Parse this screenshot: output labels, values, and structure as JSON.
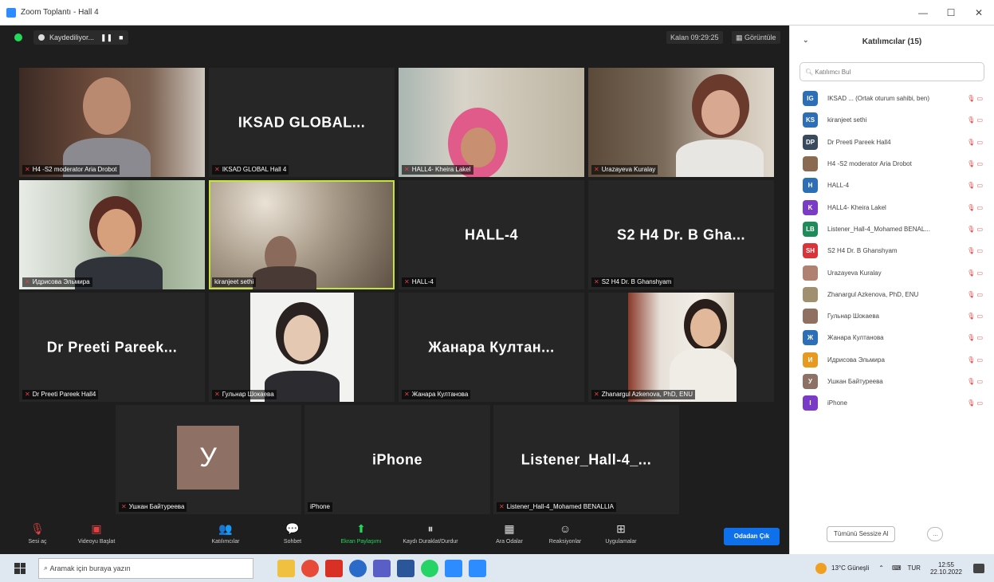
{
  "window": {
    "title": "Zoom Toplantı - Hall 4",
    "minimize": "—",
    "maximize": "☐",
    "close": "✕"
  },
  "topbar": {
    "recording": "Kaydediliyor...",
    "pause": "❚❚",
    "stop": "■",
    "timer": "Kalan 09:29:25",
    "view": "Görüntüle"
  },
  "tiles": {
    "t1": {
      "label": "H4 -S2 moderator Aria Drobot"
    },
    "t2": {
      "big": "IKSAD GLOBAL...",
      "label": "IKSAD GLOBAL Hall 4"
    },
    "t3": {
      "label": "HALL4- Kheira Lakel"
    },
    "t4": {
      "label": "Urazayeva Kuralay"
    },
    "t5": {
      "label": "Идрисова Эльмира"
    },
    "t6": {
      "label": "kiranjeet sethi"
    },
    "t7": {
      "big": "HALL-4",
      "label": "HALL-4"
    },
    "t8": {
      "big": "S2 H4 Dr. B Gha...",
      "label": "S2 H4 Dr. B Ghanshyam"
    },
    "t9": {
      "big": "Dr Preeti Pareek...",
      "label": "Dr Preeti Pareek Hall4"
    },
    "t10": {
      "label": "Гульнар Шокаева"
    },
    "t11": {
      "big": "Жанара Култан...",
      "label": "Жанара Култанова"
    },
    "t12": {
      "label": "Zhanargul Azkenova, PhD, ENU"
    },
    "t13": {
      "avatar": "У",
      "label": "Ушкан Байтуреева"
    },
    "t14": {
      "big": "iPhone",
      "label": "iPhone"
    },
    "t15": {
      "big": "Listener_Hall-4_...",
      "label": "Listener_Hall-4_Mohamed BENALLIA"
    }
  },
  "toolbar": {
    "audio": "Sesi aç",
    "video": "Videoyu Başlat",
    "participants": "Katılımcılar",
    "participants_count": "15",
    "chat": "Sohbet",
    "share": "Ekran Paylaşımı",
    "record": "Kaydı Duraklat/Durdur",
    "breakout": "Ara Odalar",
    "reactions": "Reaksiyonlar",
    "apps": "Uygulamalar",
    "leave": "Odadan Çık"
  },
  "panel": {
    "title": "Katılımcılar (15)",
    "search_placeholder": "Katılımcı Bul",
    "participants": [
      {
        "initials": "IG",
        "color": "#2d6fb7",
        "name": "IKSAD ... (Ortak oturum sahibi, ben)"
      },
      {
        "initials": "KS",
        "color": "#2d6fb7",
        "name": "kiranjeet sethi"
      },
      {
        "initials": "DP",
        "color": "#3a4a5e",
        "name": "Dr Preeti Pareek Hall4"
      },
      {
        "initials": "",
        "color": "#8a6a50",
        "name": "H4 -S2 moderator Aria Drobot"
      },
      {
        "initials": "H",
        "color": "#2d6fb7",
        "name": "HALL-4"
      },
      {
        "initials": "K",
        "color": "#7a3cc7",
        "name": "HALL4- Kheira Lakel"
      },
      {
        "initials": "LB",
        "color": "#1f8a5a",
        "name": "Listener_Hall-4_Mohamed BENAL..."
      },
      {
        "initials": "SH",
        "color": "#d8343a",
        "name": "S2 H4 Dr. B Ghanshyam"
      },
      {
        "initials": "",
        "color": "#b08070",
        "name": "Urazayeva Kuralay"
      },
      {
        "initials": "",
        "color": "#a09070",
        "name": "Zhanargul Azkenova, PhD, ENU"
      },
      {
        "initials": "",
        "color": "#907060",
        "name": "Гульнар Шокаева"
      },
      {
        "initials": "Ж",
        "color": "#2d6fb7",
        "name": "Жанара Култанова"
      },
      {
        "initials": "И",
        "color": "#e89a20",
        "name": "Идрисова Эльмира"
      },
      {
        "initials": "У",
        "color": "#8f7065",
        "name": "Ушкан Байтуреева"
      },
      {
        "initials": "I",
        "color": "#7a3cc7",
        "name": "iPhone"
      }
    ],
    "mute_all": "Tümünü Sessize Al",
    "more": "..."
  },
  "taskbar": {
    "search": "Aramak için buraya yazın",
    "weather": "13°C Güneşli",
    "lang": "TUR",
    "time": "12:55",
    "date": "22.10.2022"
  }
}
